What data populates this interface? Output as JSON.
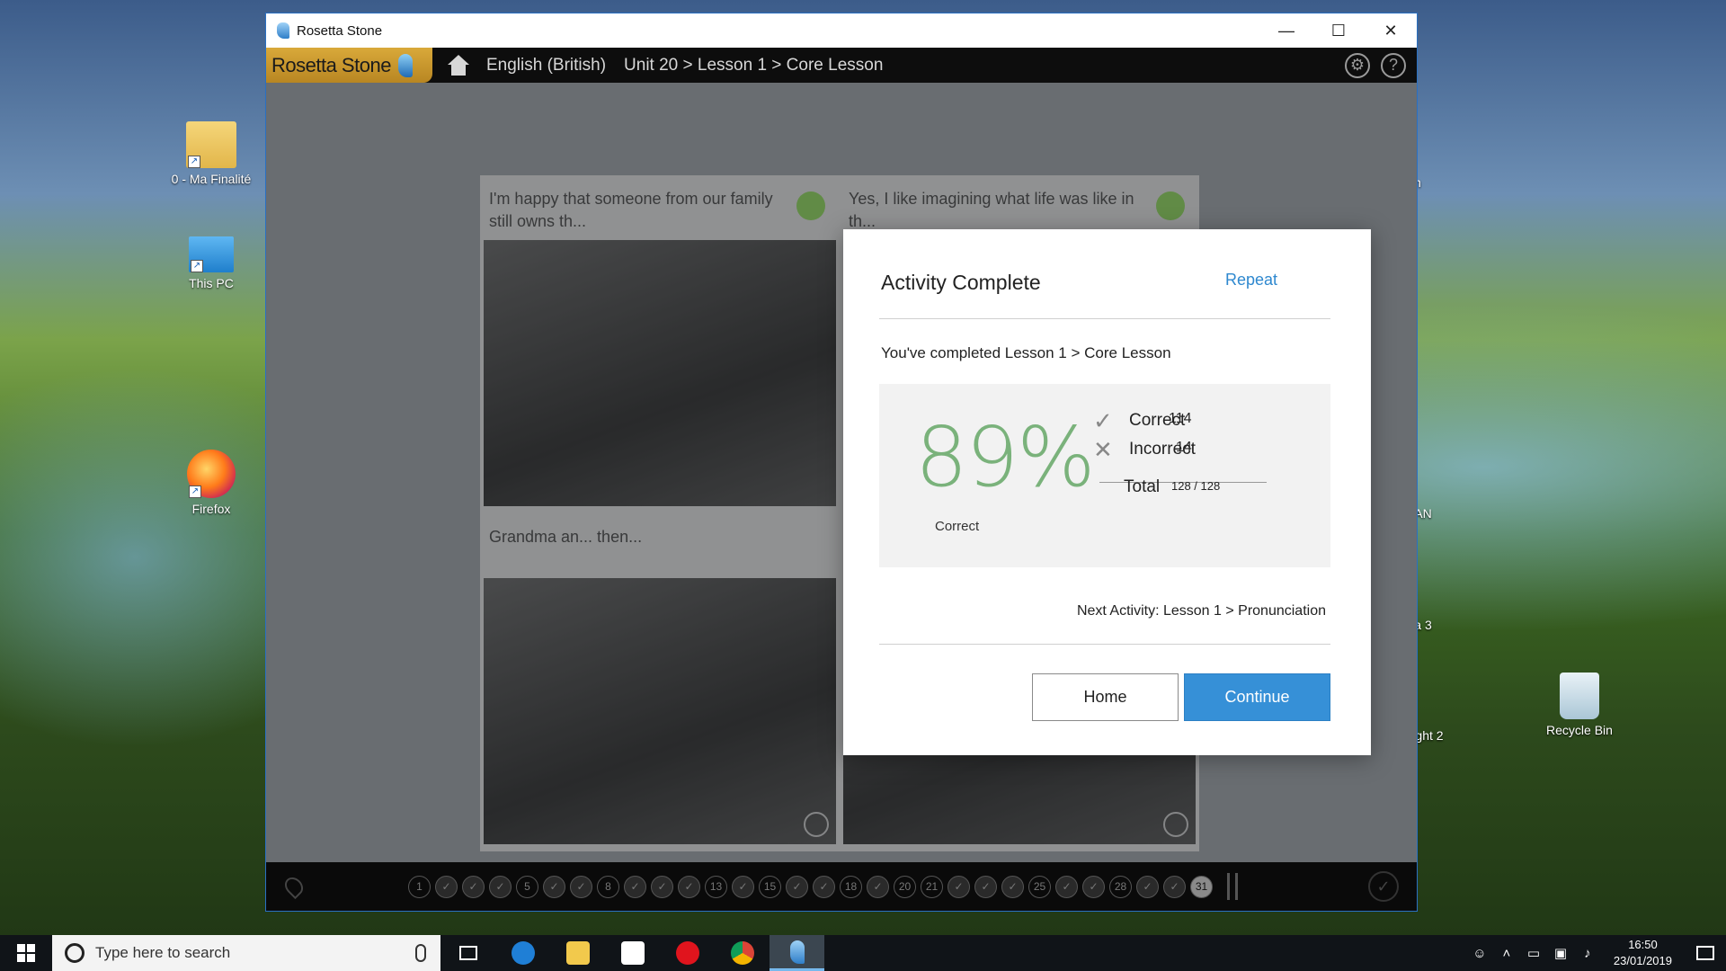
{
  "desktop": {
    "icons": [
      {
        "label": "0 - Ma Finalité",
        "icon": "folder-icon"
      },
      {
        "label": "This PC",
        "icon": "computer-icon"
      },
      {
        "label": "Firefox",
        "icon": "firefox-icon"
      },
      {
        "label": "Recycle Bin",
        "icon": "recycle-bin-icon"
      }
    ],
    "partial_labels": [
      "m",
      "AN",
      "a 3",
      "ght 2"
    ]
  },
  "window": {
    "title": "Rosetta Stone",
    "controls": {
      "minimize": "—",
      "maximize": "☐",
      "close": "✕"
    }
  },
  "appbar": {
    "logo": "Rosetta Stone",
    "language": "English (British)",
    "breadcrumb": "Unit 20 > Lesson 1 > Core Lesson",
    "settings_icon": "gear-icon",
    "help_icon": "?"
  },
  "lesson": {
    "cells": [
      {
        "caption": "I'm happy that someone from our family still owns th..."
      },
      {
        "caption": "Yes, I like imagining what life was like in th..."
      },
      {
        "caption": "Grandma an... then..."
      },
      {
        "caption": ""
      }
    ]
  },
  "progress": {
    "items": [
      "1",
      "✓",
      "✓",
      "✓",
      "5",
      "✓",
      "✓",
      "8",
      "✓",
      "✓",
      "✓",
      "13",
      "✓",
      "15",
      "✓",
      "✓",
      "18",
      "✓",
      "20",
      "21",
      "✓",
      "✓",
      "✓",
      "25",
      "✓",
      "✓",
      "28",
      "✓",
      "✓",
      "31"
    ],
    "current": "31"
  },
  "modal": {
    "title": "Activity Complete",
    "repeat": "Repeat",
    "completed_text": "You've completed Lesson 1 > Core Lesson",
    "score_percent": "89%",
    "score_label": "Correct",
    "correct_label": "Correct",
    "correct_value": "114",
    "incorrect_label": "Incorrect",
    "incorrect_value": "14",
    "total_label": "Total",
    "total_value": "128 / 128",
    "next_activity": "Next Activity: Lesson 1 > Pronunciation",
    "home_button": "Home",
    "continue_button": "Continue"
  },
  "taskbar": {
    "search_placeholder": "Type here to search",
    "time": "16:50",
    "date": "23/01/2019"
  },
  "colors": {
    "accent": "#3690d7",
    "score_green": "#7ab27b",
    "logo_gold": "#c99a2e",
    "speaker_green": "#6aa043"
  }
}
